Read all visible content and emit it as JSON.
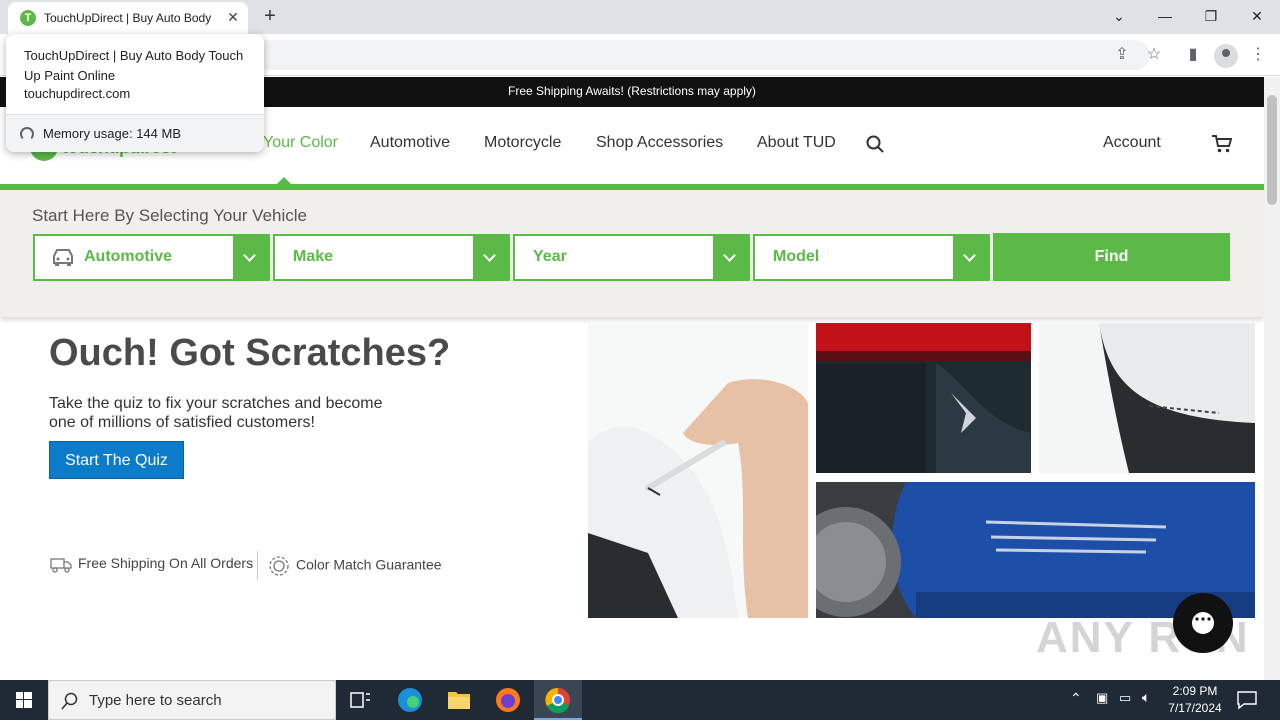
{
  "browser": {
    "tab_title": "TouchUpDirect | Buy Auto Body",
    "favicon_letter": "T",
    "hover_card": {
      "title": "TouchUpDirect | Buy Auto Body Touch Up Paint Online",
      "url": "touchupdirect.com",
      "memory": "Memory usage: 144 MB"
    }
  },
  "site": {
    "promo": "Free Shipping Awaits! (Restrictions may apply)",
    "logo_text": "touchupdirect",
    "nav": [
      "Your Color",
      "Automotive",
      "Motorcycle",
      "Shop Accessories",
      "About TUD"
    ],
    "account": "Account",
    "selector": {
      "heading": "Start Here By Selecting Your Vehicle",
      "fields": [
        "Automotive",
        "Make",
        "Year",
        "Model"
      ],
      "find": "Find"
    },
    "hero": {
      "title": "Ouch! Got Scratches?",
      "subtitle": "Take the quiz to fix your scratches and become one of millions of satisfied customers!",
      "cta": "Start The Quiz"
    },
    "features": [
      "Free Shipping On All Orders",
      "Color Match Guarantee"
    ],
    "brand_color": "#5bb947",
    "cta_color": "#0c7bc9"
  },
  "watermark": "ANY RUN",
  "taskbar": {
    "search_placeholder": "Type here to search",
    "time": "2:09 PM",
    "date": "7/17/2024"
  }
}
